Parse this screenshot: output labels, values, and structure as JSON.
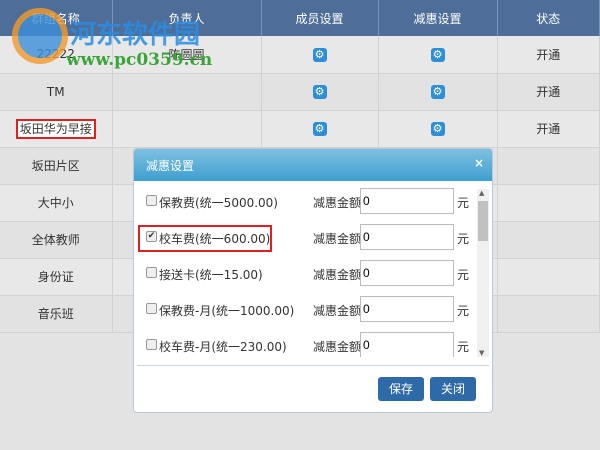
{
  "watermark": {
    "brand": "河东软件园",
    "url": "www.pc0359.cn"
  },
  "table": {
    "headers": [
      "群组名称",
      "负责人",
      "成员设置",
      "减惠设置",
      "状态"
    ],
    "rows": [
      {
        "name": "22222",
        "owner": "陈圆圆",
        "status": "开通"
      },
      {
        "name": "TM",
        "owner": "",
        "status": "开通"
      },
      {
        "name": "坂田华为早接",
        "owner": "",
        "status": "开通"
      },
      {
        "name": "坂田片区",
        "owner": "",
        "status": ""
      },
      {
        "name": "大中小",
        "owner": "",
        "status": ""
      },
      {
        "name": "全体教师",
        "owner": "",
        "status": ""
      },
      {
        "name": "身份证",
        "owner": "",
        "status": ""
      },
      {
        "name": "音乐班",
        "owner": "",
        "status": ""
      }
    ]
  },
  "dialog": {
    "title": "减惠设置",
    "close": "×",
    "amount_label": "减惠金额",
    "unit": "元",
    "items": [
      {
        "label": "保教费(统一5000.00)",
        "checked": false,
        "value": "0"
      },
      {
        "label": "校车费(统一600.00)",
        "checked": true,
        "value": "0"
      },
      {
        "label": "接送卡(统一15.00)",
        "checked": false,
        "value": "0"
      },
      {
        "label": "保教费-月(统一1000.00)",
        "checked": false,
        "value": "0"
      },
      {
        "label": "校车费-月(统一230.00)",
        "checked": false,
        "value": "0"
      }
    ],
    "save": "保存",
    "cancel": "关闭"
  }
}
